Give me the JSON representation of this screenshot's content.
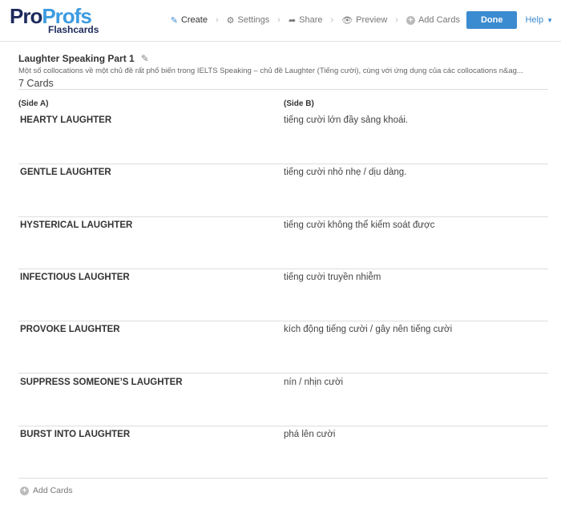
{
  "logo": {
    "pro": "Pro",
    "profs": "Profs",
    "sub": "Flashcards"
  },
  "nav": {
    "create": "Create",
    "settings": "Settings",
    "share": "Share",
    "preview": "Preview",
    "add_cards": "Add Cards",
    "done": "Done",
    "help": "Help"
  },
  "set": {
    "title": "Laughter Speaking Part 1",
    "description": "Một số collocations về một chủ đề rất phổ biến trong IELTS Speaking – chủ đề Laughter (Tiếng cười), cùng với ứng dụng của các collocations n&ag...",
    "count": "7 Cards"
  },
  "columns": {
    "side_a": "(Side A)",
    "side_b": "(Side B)"
  },
  "cards": [
    {
      "a": "HEARTY LAUGHTER",
      "b": "tiếng cười lớn đầy sảng khoái."
    },
    {
      "a": "GENTLE LAUGHTER",
      "b": "tiếng cười nhỏ nhẹ / dịu dàng."
    },
    {
      "a": "HYSTERICAL LAUGHTER",
      "b": "tiếng cười không thể kiểm soát được"
    },
    {
      "a": "INFECTIOUS LAUGHTER",
      "b": "tiếng cười truyền nhiễm"
    },
    {
      "a": "PROVOKE LAUGHTER",
      "b": "kích động tiếng cười / gây nên tiếng cười"
    },
    {
      "a": "SUPPRESS SOMEONE’S LAUGHTER",
      "b": "nín / nhịn cười"
    },
    {
      "a": "BURST INTO LAUGHTER",
      "b": "phá lên cười"
    }
  ],
  "footer": {
    "add_cards": "Add Cards"
  },
  "colors": {
    "accent": "#3b8bd0",
    "logo_dark": "#1d2a5c",
    "logo_light": "#3d9be0"
  }
}
